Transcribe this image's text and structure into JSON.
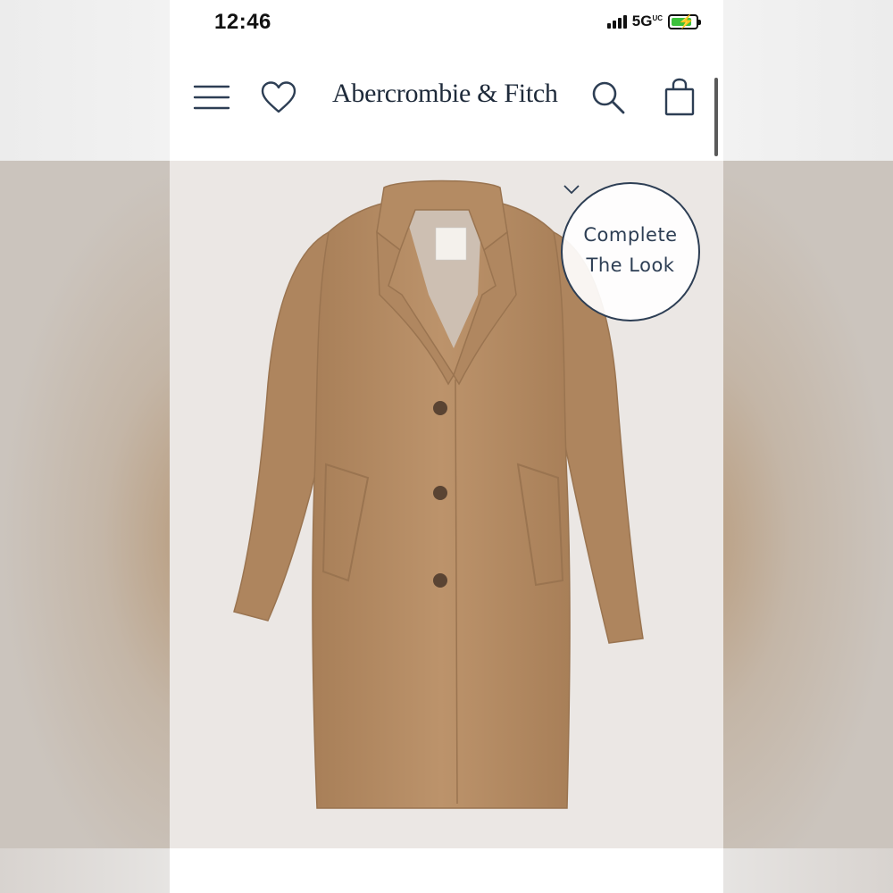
{
  "status_bar": {
    "time": "12:46",
    "network": "5G",
    "network_suffix": "UC",
    "battery_state": "charging",
    "battery_color": "#3cc13b"
  },
  "nav": {
    "brand": "Abercrombie & Fitch",
    "icons": [
      "menu-icon",
      "heart-icon",
      "search-icon",
      "shopping-bag-icon"
    ]
  },
  "product": {
    "image": "camel-wool-coat",
    "coat_color": "#b88e66"
  },
  "complete_look": {
    "line1": "Complete",
    "line2": "The Look",
    "icon": "chevron-down-icon",
    "accent": "#2d3e54"
  }
}
